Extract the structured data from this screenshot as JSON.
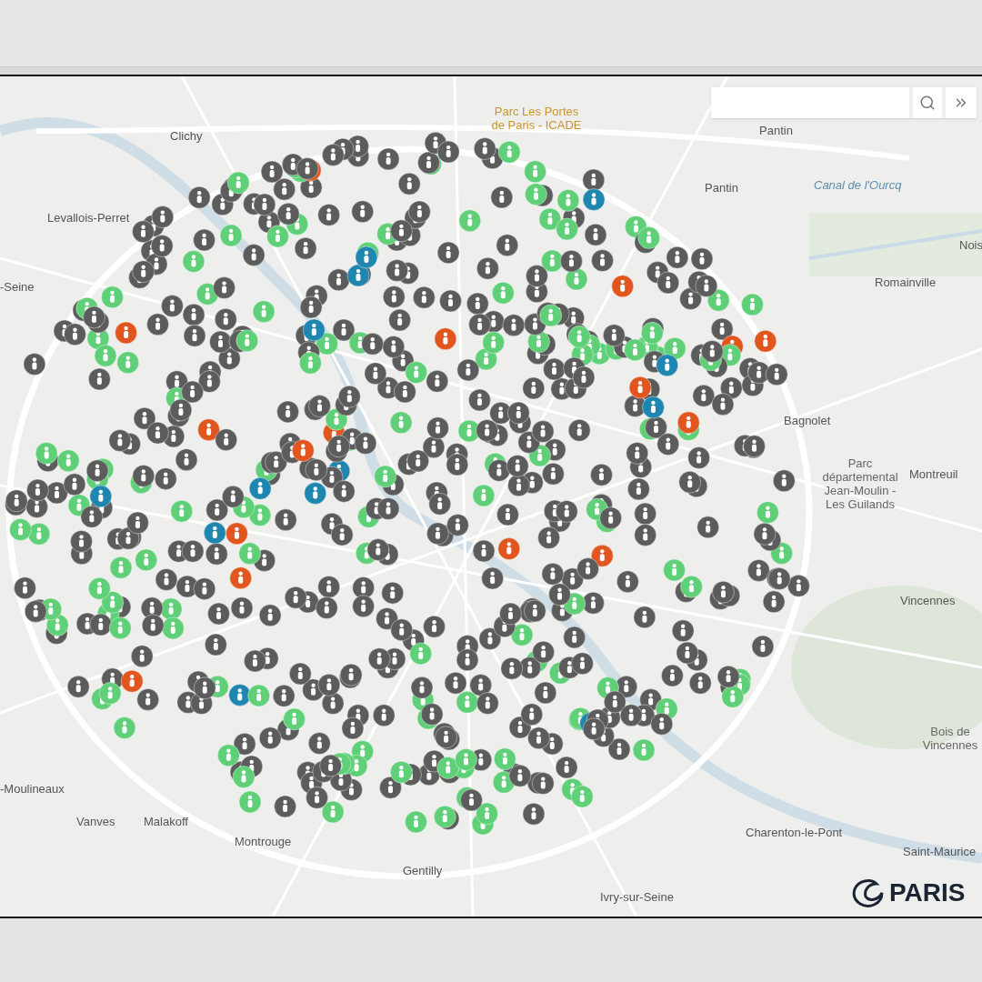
{
  "map": {
    "places": [
      {
        "name": "Clichy",
        "kind": "town"
      },
      {
        "name": "Levallois-Perret",
        "kind": "town"
      },
      {
        "name": "Parc Les Portes de Paris - ICADE",
        "kind": "park"
      },
      {
        "name": "Pantin",
        "kind": "town"
      },
      {
        "name": "Pantin",
        "kind": "town"
      },
      {
        "name": "Canal de l'Ourcq",
        "kind": "water"
      },
      {
        "name": "Nois",
        "kind": "town"
      },
      {
        "name": "Romainville",
        "kind": "town"
      },
      {
        "name": "-Seine",
        "kind": "town"
      },
      {
        "name": "Bagnolet",
        "kind": "town"
      },
      {
        "name": "Parc départemental Jean-Moulin - Les Guilands",
        "kind": "park-gray"
      },
      {
        "name": "Montreuil",
        "kind": "town"
      },
      {
        "name": "Vincennes",
        "kind": "town"
      },
      {
        "name": "Bois de Vincennes",
        "kind": "park-gray"
      },
      {
        "name": "Charenton-le-Pont",
        "kind": "town"
      },
      {
        "name": "Saint-Maurice",
        "kind": "town"
      },
      {
        "name": "Ivry-sur-Seine",
        "kind": "town"
      },
      {
        "name": "Gentilly",
        "kind": "town"
      },
      {
        "name": "Montrouge",
        "kind": "town"
      },
      {
        "name": "Malakoff",
        "kind": "town"
      },
      {
        "name": "Vanves",
        "kind": "town"
      },
      {
        "name": "-Moulineaux",
        "kind": "town"
      }
    ]
  },
  "logo": {
    "text": "PARIS"
  }
}
